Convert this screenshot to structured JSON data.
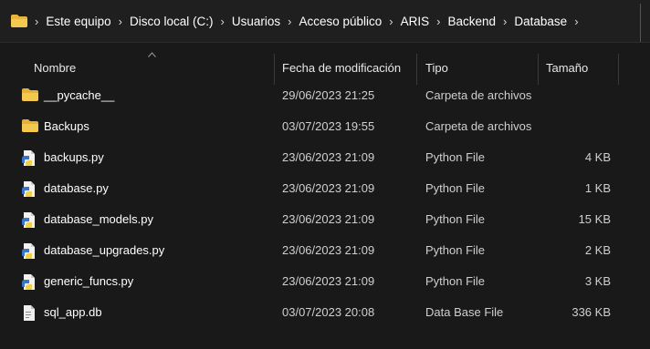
{
  "address_bar": {
    "path": [
      "Este equipo",
      "Disco local (C:)",
      "Usuarios",
      "Acceso público",
      "ARIS",
      "Backend",
      "Database"
    ],
    "separator": "›"
  },
  "columns": {
    "name": "Nombre",
    "date": "Fecha de modificación",
    "type": "Tipo",
    "size": "Tamaño"
  },
  "files": [
    {
      "name": "__pycache__",
      "date": "29/06/2023 21:25",
      "type": "Carpeta de archivos",
      "size": "",
      "icon": "folder-icon"
    },
    {
      "name": "Backups",
      "date": "03/07/2023 19:55",
      "type": "Carpeta de archivos",
      "size": "",
      "icon": "folder-icon"
    },
    {
      "name": "backups.py",
      "date": "23/06/2023 21:09",
      "type": "Python File",
      "size": "4 KB",
      "icon": "python-file-icon"
    },
    {
      "name": "database.py",
      "date": "23/06/2023 21:09",
      "type": "Python File",
      "size": "1 KB",
      "icon": "python-file-icon"
    },
    {
      "name": "database_models.py",
      "date": "23/06/2023 21:09",
      "type": "Python File",
      "size": "15 KB",
      "icon": "python-file-icon"
    },
    {
      "name": "database_upgrades.py",
      "date": "23/06/2023 21:09",
      "type": "Python File",
      "size": "2 KB",
      "icon": "python-file-icon"
    },
    {
      "name": "generic_funcs.py",
      "date": "23/06/2023 21:09",
      "type": "Python File",
      "size": "3 KB",
      "icon": "python-file-icon"
    },
    {
      "name": "sql_app.db",
      "date": "03/07/2023 20:08",
      "type": "Data Base File",
      "size": "336 KB",
      "icon": "database-file-icon"
    }
  ],
  "colors": {
    "background": "#191919",
    "folder": "#f0c04a",
    "python_blue": "#3a74c8",
    "python_yellow": "#f3cf4c",
    "text": "#ffffff"
  }
}
